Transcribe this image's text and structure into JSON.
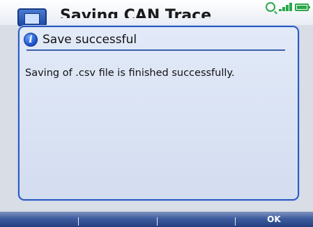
{
  "app": {
    "title": "Saving CAN Trace",
    "app_icon": "monitor-icon",
    "status_icons": [
      "search-icon",
      "signal-icon",
      "battery-icon"
    ]
  },
  "dialog": {
    "icon": "info-icon",
    "icon_glyph": "i",
    "title": "Save successful",
    "message": "Saving of .csv file is finished successfully."
  },
  "softkeys": [
    {
      "label": ""
    },
    {
      "label": ""
    },
    {
      "label": ""
    },
    {
      "label": "OK"
    }
  ],
  "colors": {
    "accent": "#2a5bc2",
    "dialog_bg": "#dbe3f4",
    "softkey_bar": "#3e5d9f",
    "status_green": "#2aa84a"
  }
}
